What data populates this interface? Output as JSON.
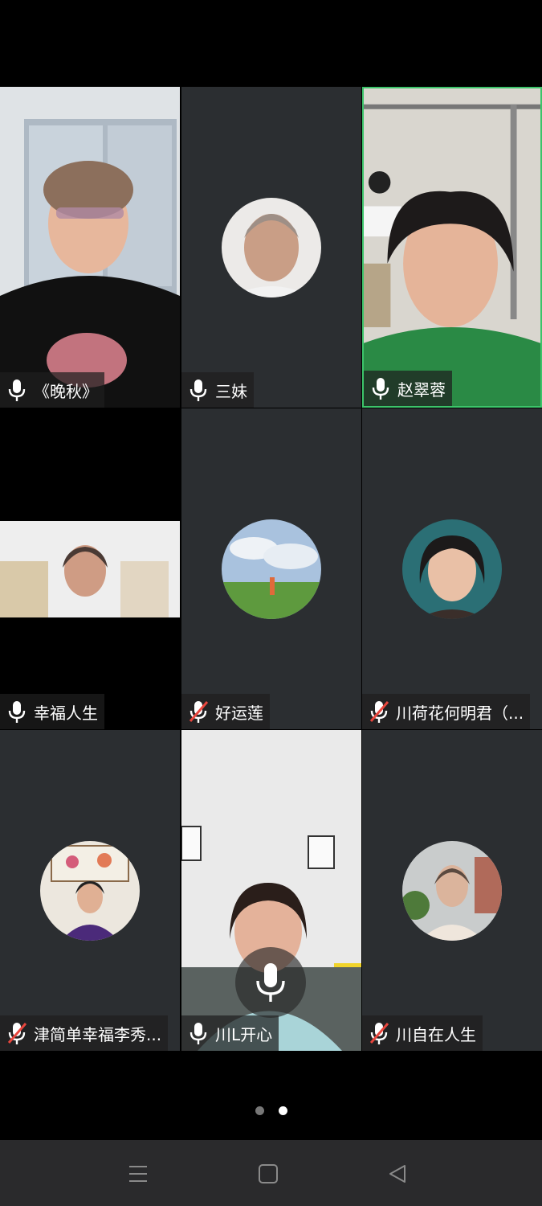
{
  "participants": [
    {
      "name": "《晚秋》",
      "muted": false
    },
    {
      "name": "三妹",
      "muted": false
    },
    {
      "name": "赵翠蓉",
      "muted": false
    },
    {
      "name": "幸福人生",
      "muted": false
    },
    {
      "name": "好运莲",
      "muted": true
    },
    {
      "name": "川荷花何明君（...",
      "muted": true
    },
    {
      "name": "津简单幸福李秀...",
      "muted": true
    },
    {
      "name": "川L开心",
      "muted": false
    },
    {
      "name": "川自在人生",
      "muted": true
    }
  ],
  "pager": {
    "count": 2,
    "current": 2
  },
  "colors": {
    "active_border": "#3cc46a",
    "tile_bg": "#2b2e31"
  }
}
